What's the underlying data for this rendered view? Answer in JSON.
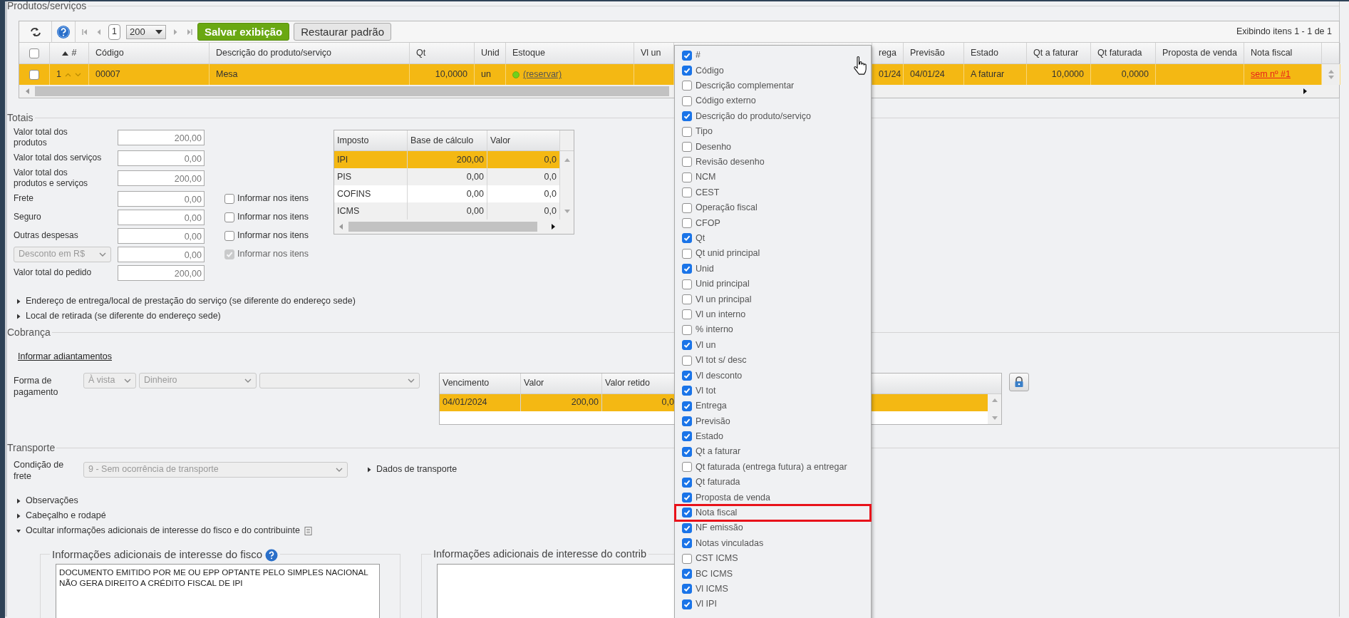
{
  "products": {
    "title": "Produtos/serviços",
    "toolbar": {
      "page": "1",
      "page_size": "200",
      "save_label": "Salvar exibição",
      "reset_label": "Restaurar padrão",
      "summary": "Exibindo itens 1 - 1 de 1"
    },
    "columns": [
      {
        "kind": "check",
        "checked": false
      },
      {
        "kind": "sort",
        "label": "#"
      },
      {
        "kind": "text",
        "label": "Código"
      },
      {
        "kind": "text",
        "label": "Descrição do produto/serviço"
      },
      {
        "kind": "text",
        "label": "Qt"
      },
      {
        "kind": "text",
        "label": "Unid"
      },
      {
        "kind": "text",
        "label": "Estoque"
      },
      {
        "kind": "text",
        "label": "Vl un"
      },
      {
        "kind": "covered"
      },
      {
        "kind": "text",
        "label": "rega"
      },
      {
        "kind": "text",
        "label": "Previsão"
      },
      {
        "kind": "text",
        "label": "Estado"
      },
      {
        "kind": "text",
        "label": "Qt a faturar"
      },
      {
        "kind": "text",
        "label": "Qt faturada"
      },
      {
        "kind": "text",
        "label": "Proposta de venda"
      },
      {
        "kind": "text",
        "label": "Nota fiscal"
      }
    ],
    "rows": [
      {
        "selected": true,
        "cells": [
          {
            "kind": "check",
            "checked": false
          },
          {
            "kind": "order",
            "text": "1"
          },
          {
            "kind": "text",
            "text": "00007"
          },
          {
            "kind": "text",
            "text": "Mesa"
          },
          {
            "kind": "number",
            "text": "10,0000"
          },
          {
            "kind": "text",
            "text": "un"
          },
          {
            "kind": "stock",
            "text": "(reservar)"
          },
          {
            "kind": "blank"
          },
          {
            "kind": "covered"
          },
          {
            "kind": "text",
            "text": "01/24"
          },
          {
            "kind": "text",
            "text": "04/01/24"
          },
          {
            "kind": "text",
            "text": "A faturar"
          },
          {
            "kind": "number",
            "text": "10,0000"
          },
          {
            "kind": "number",
            "text": "0,0000"
          },
          {
            "kind": "blank"
          },
          {
            "kind": "link",
            "text": "sem nº #1"
          }
        ]
      }
    ]
  },
  "column_menu": {
    "items": [
      {
        "label": "#",
        "checked": true,
        "highlighted": false
      },
      {
        "label": "Código",
        "checked": true,
        "highlighted": false
      },
      {
        "label": "Descrição complementar",
        "checked": false,
        "highlighted": false
      },
      {
        "label": "Código externo",
        "checked": false,
        "highlighted": false
      },
      {
        "label": "Descrição do produto/serviço",
        "checked": true,
        "highlighted": false
      },
      {
        "label": "Tipo",
        "checked": false,
        "highlighted": false
      },
      {
        "label": "Desenho",
        "checked": false,
        "highlighted": false
      },
      {
        "label": "Revisão desenho",
        "checked": false,
        "highlighted": false
      },
      {
        "label": "NCM",
        "checked": false,
        "highlighted": false
      },
      {
        "label": "CEST",
        "checked": false,
        "highlighted": false
      },
      {
        "label": "Operação fiscal",
        "checked": false,
        "highlighted": false
      },
      {
        "label": "CFOP",
        "checked": false,
        "highlighted": false
      },
      {
        "label": "Qt",
        "checked": true,
        "highlighted": false
      },
      {
        "label": "Qt unid principal",
        "checked": false,
        "highlighted": false
      },
      {
        "label": "Unid",
        "checked": true,
        "highlighted": false
      },
      {
        "label": "Unid principal",
        "checked": false,
        "highlighted": false
      },
      {
        "label": "Vl un principal",
        "checked": false,
        "highlighted": false
      },
      {
        "label": "Vl un interno",
        "checked": false,
        "highlighted": false
      },
      {
        "label": "% interno",
        "checked": false,
        "highlighted": false
      },
      {
        "label": "Vl un",
        "checked": true,
        "highlighted": false
      },
      {
        "label": "Vl tot s/ desc",
        "checked": false,
        "highlighted": false
      },
      {
        "label": "Vl desconto",
        "checked": true,
        "highlighted": false
      },
      {
        "label": "Vl tot",
        "checked": true,
        "highlighted": false
      },
      {
        "label": "Entrega",
        "checked": true,
        "highlighted": false
      },
      {
        "label": "Previsão",
        "checked": true,
        "highlighted": false
      },
      {
        "label": "Estado",
        "checked": true,
        "highlighted": false
      },
      {
        "label": "Qt a faturar",
        "checked": true,
        "highlighted": false
      },
      {
        "label": "Qt faturada (entrega futura) a entregar",
        "checked": false,
        "highlighted": false
      },
      {
        "label": "Qt faturada",
        "checked": true,
        "highlighted": false
      },
      {
        "label": "Proposta de venda",
        "checked": true,
        "highlighted": false
      },
      {
        "label": "Nota fiscal",
        "checked": true,
        "highlighted": true
      },
      {
        "label": "NF emissão",
        "checked": true,
        "highlighted": false
      },
      {
        "label": "Notas vinculadas",
        "checked": true,
        "highlighted": false
      },
      {
        "label": "CST ICMS",
        "checked": false,
        "highlighted": false
      },
      {
        "label": "BC ICMS",
        "checked": true,
        "highlighted": false
      },
      {
        "label": "Vl ICMS",
        "checked": true,
        "highlighted": false
      },
      {
        "label": "Vl IPI",
        "checked": true,
        "highlighted": false
      }
    ]
  },
  "totals": {
    "title": "Totais",
    "fields": [
      {
        "kind": "input",
        "label": "Valor total dos produtos",
        "value": "200,00"
      },
      {
        "kind": "input",
        "label": "Valor total dos serviços",
        "value": "0,00"
      },
      {
        "kind": "input",
        "label": "Valor total dos produtos e serviços",
        "value": "200,00"
      },
      {
        "kind": "input",
        "label": "Frete",
        "value": "0,00",
        "option": {
          "label": "Informar nos itens",
          "checked": false,
          "disabled": false
        }
      },
      {
        "kind": "input",
        "label": "Seguro",
        "value": "0,00",
        "option": {
          "label": "Informar nos itens",
          "checked": false,
          "disabled": false
        }
      },
      {
        "kind": "input",
        "label": "Outras despesas",
        "value": "0,00",
        "option": {
          "label": "Informar nos itens",
          "checked": false,
          "disabled": false
        }
      },
      {
        "kind": "select",
        "select": "Desconto em R$",
        "value": "0,00",
        "option": {
          "label": "Informar nos itens",
          "checked": true,
          "disabled": true
        }
      },
      {
        "kind": "input",
        "label": "Valor total do pedido",
        "value": "200,00"
      }
    ],
    "taxes": {
      "columns": [
        "Imposto",
        "Base de cálculo",
        "Valor"
      ],
      "rows": [
        {
          "selected": true,
          "cells": [
            "IPI",
            "200,00",
            "0,0"
          ]
        },
        {
          "selected": false,
          "cells": [
            "PIS",
            "0,00",
            "0,0"
          ]
        },
        {
          "selected": false,
          "cells": [
            "COFINS",
            "0,00",
            "0,0"
          ]
        },
        {
          "selected": false,
          "cells": [
            "ICMS",
            "0,00",
            "0,0"
          ]
        }
      ]
    }
  },
  "expanders": [
    {
      "label": "Endereço de entrega/local de prestação do serviço (se diferente do endereço sede)",
      "expanded": false
    },
    {
      "label": "Local de retirada (se diferente do endereço sede)",
      "expanded": false
    }
  ],
  "billing": {
    "title": "Cobrança",
    "advance_link": "Informar adiantamentos",
    "payment_label": "Forma de pagamento",
    "selects": [
      "À vista",
      "Dinheiro"
    ],
    "installments": {
      "columns": [
        "Vencimento",
        "Valor",
        "Valor retido"
      ],
      "rows": [
        {
          "selected": true,
          "cells": [
            "04/01/2024",
            "200,00",
            "0,0"
          ]
        }
      ]
    }
  },
  "transport": {
    "title": "Transporte",
    "freight_label": "Condição de frete",
    "freight_value": "9 - Sem ocorrência de transporte",
    "details": {
      "label": "Dados de transporte",
      "expanded": false
    }
  },
  "sections": [
    {
      "label": "Observações",
      "expanded": false
    },
    {
      "label": "Cabeçalho e rodapé",
      "expanded": false
    },
    {
      "label": "Ocultar informações adicionais de interesse do fisco e do contribuinte",
      "expanded": true
    }
  ],
  "additional_info": [
    {
      "title": "Informações adicionais de interesse do fisco",
      "help": true,
      "text": "DOCUMENTO EMITIDO POR ME OU EPP OPTANTE PELO SIMPLES NACIONAL NÃO GERA DIREITO A CRÉDITO FISCAL DE IPI"
    },
    {
      "title": "Informações adicionais de interesse do contrib",
      "help": false
    }
  ]
}
